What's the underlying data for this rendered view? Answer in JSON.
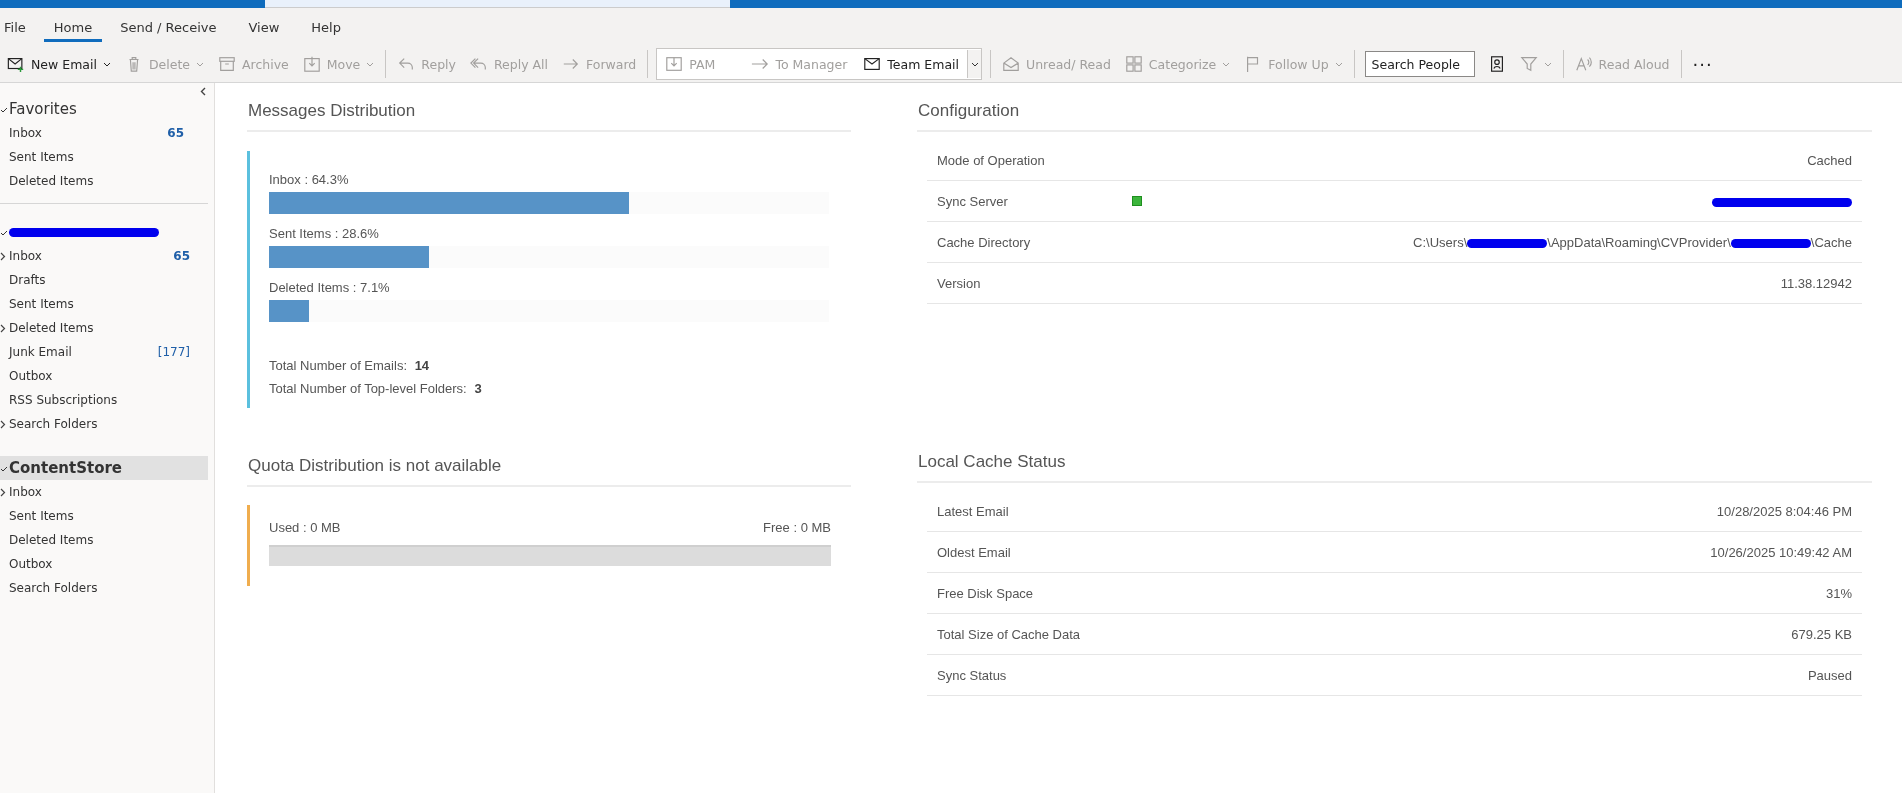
{
  "ribbon_tabs": [
    {
      "label": "File",
      "selected": false
    },
    {
      "label": "Home",
      "selected": true
    },
    {
      "label": "Send / Receive",
      "selected": false
    },
    {
      "label": "View",
      "selected": false
    },
    {
      "label": "Help",
      "selected": false
    }
  ],
  "toolbar": {
    "groups": [
      [
        {
          "label": "New Email",
          "disabled": false,
          "dropdown": true
        },
        {
          "label": "Delete",
          "disabled": true,
          "dropdown": true
        },
        {
          "label": "Archive",
          "disabled": true,
          "dropdown": false
        },
        {
          "label": "Move",
          "disabled": true,
          "dropdown": true
        }
      ],
      [
        {
          "label": "Reply",
          "disabled": true,
          "dropdown": false
        },
        {
          "label": "Reply All",
          "disabled": true,
          "dropdown": false
        },
        {
          "label": "Forward",
          "disabled": true,
          "dropdown": false
        }
      ]
    ],
    "quick_steps": [
      {
        "label": "PAM",
        "disabled": true
      },
      {
        "label": "To Manager",
        "disabled": true
      },
      {
        "label": "Team Email",
        "disabled": false
      }
    ],
    "tags": [
      {
        "label": "Unread/ Read",
        "disabled": true,
        "dropdown": false
      },
      {
        "label": "Categorize",
        "disabled": true,
        "dropdown": true
      },
      {
        "label": "Follow Up",
        "disabled": true,
        "dropdown": true
      }
    ],
    "search": {
      "placeholder": "Search People"
    },
    "read_aloud": {
      "label": "Read Aloud",
      "disabled": true
    },
    "more": "···"
  },
  "sidebar": {
    "groups": [
      {
        "header": "Favorites",
        "redacted": false,
        "expanded": true,
        "selected": false,
        "items": [
          {
            "label": "Inbox",
            "expandable": false,
            "count": "65",
            "count_bold": true
          },
          {
            "label": "Sent Items",
            "expandable": false
          },
          {
            "label": "Deleted Items",
            "expandable": false
          }
        ]
      },
      {
        "redacted": true,
        "expanded": true,
        "selected": false,
        "items": [
          {
            "label": "Inbox",
            "expandable": true,
            "count": "65",
            "count_bold": true
          },
          {
            "label": "Drafts",
            "expandable": false
          },
          {
            "label": "Sent Items",
            "expandable": false
          },
          {
            "label": "Deleted Items",
            "expandable": true
          },
          {
            "label": "Junk Email",
            "expandable": false,
            "count": "[177]",
            "count_bold": false
          },
          {
            "label": "Outbox",
            "expandable": false
          },
          {
            "label": "RSS Subscriptions",
            "expandable": false
          },
          {
            "label": "Search Folders",
            "expandable": true
          }
        ]
      },
      {
        "header": "ContentStore",
        "redacted": false,
        "expanded": true,
        "selected": true,
        "items": [
          {
            "label": "Inbox",
            "expandable": true
          },
          {
            "label": "Sent Items",
            "expandable": false
          },
          {
            "label": "Deleted Items",
            "expandable": false
          },
          {
            "label": "Outbox",
            "expandable": false
          },
          {
            "label": "Search Folders",
            "expandable": false
          }
        ]
      }
    ]
  },
  "messages_distribution": {
    "title": "Messages Distribution",
    "bars": [
      {
        "label": "Inbox : 64.3%",
        "level": 0.643
      },
      {
        "label": "Sent Items : 28.6%",
        "level": 0.286
      },
      {
        "label": "Deleted Items : 7.1%",
        "level": 0.071
      }
    ],
    "totals": [
      {
        "label": "Total Number of Emails:",
        "value": "14"
      },
      {
        "label": "Total Number of Top-level Folders:",
        "value": "3"
      }
    ]
  },
  "quota": {
    "title": "Quota Distribution is not available",
    "used": "Used : 0 MB",
    "free": "Free : 0 MB",
    "level": 0
  },
  "configuration": {
    "title": "Configuration",
    "rows": [
      {
        "label": "Mode of Operation",
        "value": [
          {
            "kind": "text",
            "text": "Cached"
          }
        ]
      },
      {
        "label": "Sync Server",
        "status": true,
        "value": [
          {
            "kind": "redacted"
          }
        ]
      },
      {
        "label": "Cache Directory",
        "value": [
          {
            "kind": "text",
            "text": "C:\\Users\\"
          },
          {
            "kind": "redacted"
          },
          {
            "kind": "text",
            "text": "\\AppData\\Roaming\\CVProvider\\"
          },
          {
            "kind": "redacted"
          },
          {
            "kind": "text",
            "text": "\\Cache"
          }
        ]
      },
      {
        "label": "Version",
        "value": [
          {
            "kind": "text",
            "text": "11.38.12942"
          }
        ]
      }
    ]
  },
  "local_cache_status": {
    "title": "Local Cache Status",
    "rows": [
      {
        "label": "Latest Email",
        "value": "10/28/2025 8:04:46 PM"
      },
      {
        "label": "Oldest Email",
        "value": "10/26/2025 10:49:42 AM"
      },
      {
        "label": "Free Disk Space",
        "value": "31%"
      },
      {
        "label": "Total Size of Cache Data",
        "value": "679.25 KB"
      },
      {
        "label": "Sync Status",
        "value": "Paused"
      }
    ]
  }
}
